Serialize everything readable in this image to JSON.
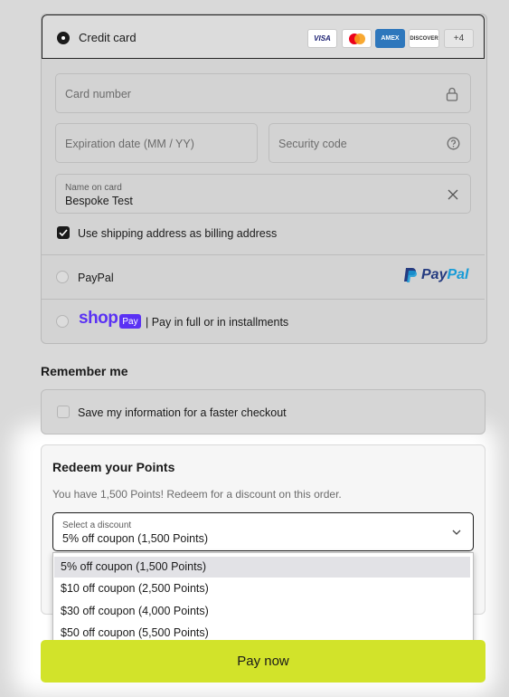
{
  "payment": {
    "credit_card_label": "Credit card",
    "card_logos": [
      "VISA",
      "MC",
      "AMEX",
      "DISCOVER"
    ],
    "more_cards": "+4",
    "card_number_placeholder": "Card number",
    "expiration_placeholder": "Expiration date (MM / YY)",
    "security_code_placeholder": "Security code",
    "name_on_card_label": "Name on card",
    "name_on_card_value": "Bespoke Test",
    "billing_checkbox_label": "Use shipping address as billing address",
    "billing_checked": true,
    "paypal_label": "PayPal",
    "paypal_logo_a": "Pay",
    "paypal_logo_b": "Pal",
    "shop_logo_text": "shop",
    "shop_pay_badge": "Pay",
    "shop_pay_description": "| Pay in full or in installments"
  },
  "remember": {
    "title": "Remember me",
    "save_info_label": "Save my information for a faster checkout",
    "checked": false
  },
  "points": {
    "title": "Redeem your Points",
    "subtitle": "You have 1,500 Points! Redeem for a discount on this order.",
    "select_label": "Select a discount",
    "select_value": "5% off coupon (1,500 Points)",
    "options": [
      {
        "label": "5% off coupon (1,500 Points)",
        "selected": true
      },
      {
        "label": "$10 off coupon (2,500 Points)",
        "selected": false
      },
      {
        "label": "$30 off coupon (4,000 Points)",
        "selected": false
      },
      {
        "label": "$50 off coupon (5,500 Points)",
        "selected": false
      }
    ]
  },
  "pay_button_label": "Pay now",
  "colors": {
    "accent": "#d2e32a",
    "shop_purple": "#5a31f4",
    "paypal_dark": "#253b80",
    "paypal_light": "#179bd7",
    "amex_blue": "#2e77bc"
  }
}
